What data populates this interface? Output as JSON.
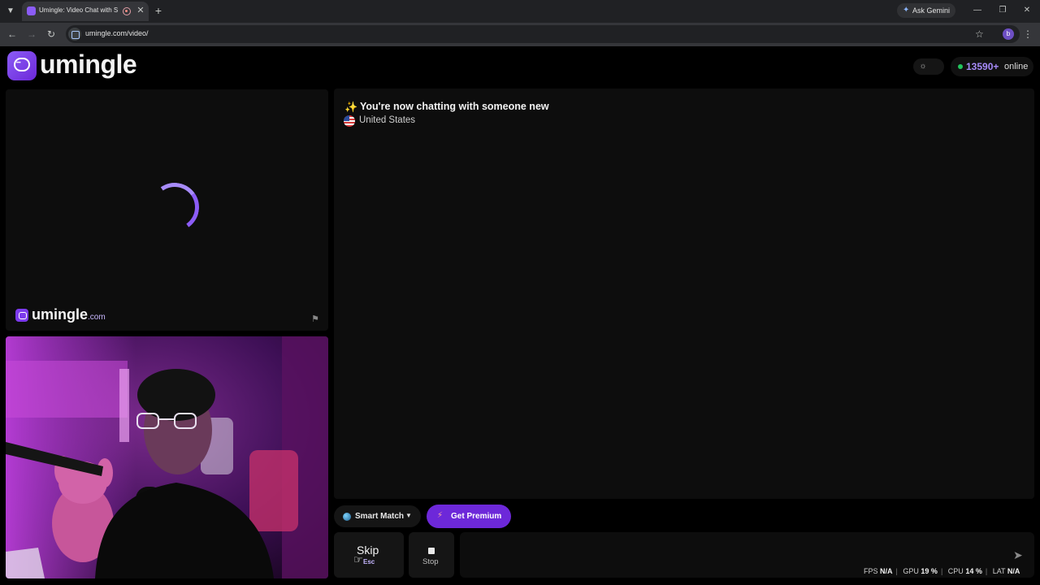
{
  "browser": {
    "tab_title": "Umingle: Video Chat with S",
    "url": "umingle.com/video/",
    "ask_gemini_label": "Ask Gemini",
    "profile_initial": "b"
  },
  "header": {
    "logo_text": "umingle",
    "online_count": "13590+",
    "online_label": "online"
  },
  "remote_video": {
    "watermark_text": "umingle",
    "watermark_suffix": ".com"
  },
  "chat": {
    "status_title": "You're now chatting with someone new",
    "country": "United States"
  },
  "controls": {
    "smart_match_label": "Smart Match",
    "premium_label": "Get Premium",
    "skip_label": "Skip",
    "skip_shortcut": "Esc",
    "stop_label": "Stop",
    "message_placeholder": ""
  },
  "stats": {
    "fps_label": "FPS",
    "fps_value": "N/A",
    "gpu_label": "GPU",
    "gpu_value": "19 %",
    "cpu_label": "CPU",
    "cpu_value": "14 %",
    "lat_label": "LAT",
    "lat_value": "N/A"
  },
  "colors": {
    "brand": "#7c3aed",
    "accent": "#a78bfa",
    "online": "#22c55e"
  },
  "icons": [
    "tab-search-icon",
    "recording-icon",
    "close-icon",
    "new-tab-icon",
    "gemini-icon",
    "minimize-icon",
    "restore-icon",
    "back-icon",
    "forward-icon",
    "reload-icon",
    "site-info-icon",
    "bookmark-star-icon",
    "menu-icon",
    "chat-bubble-icon",
    "sun-icon",
    "spinner-icon",
    "flag-icon",
    "sparkle-icon",
    "us-flag-icon",
    "globe-icon",
    "chevron-down-icon",
    "bolt-icon",
    "cursor-icon",
    "stop-icon",
    "send-icon"
  ]
}
